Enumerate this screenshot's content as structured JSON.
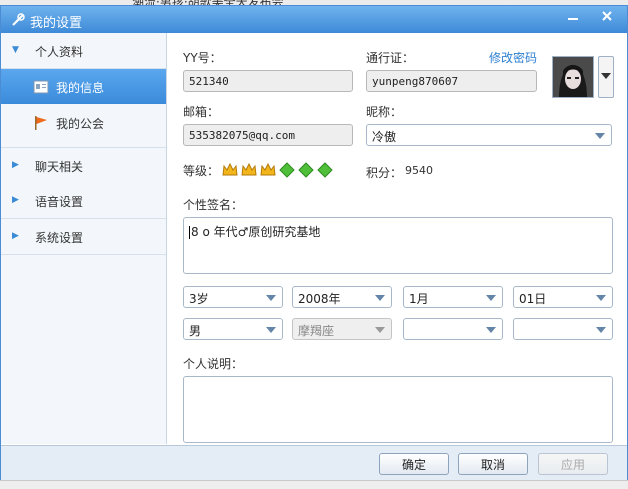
{
  "background": {
    "behind_text": "潮流·男孩·胡歌美全天发布会"
  },
  "window": {
    "title": "我的设置"
  },
  "sidebar": {
    "groups": [
      {
        "label": "个人资料",
        "expanded": true
      },
      {
        "label": "聊天相关",
        "expanded": false
      },
      {
        "label": "语音设置",
        "expanded": false
      },
      {
        "label": "系统设置",
        "expanded": false
      }
    ],
    "subitems": [
      {
        "label": "我的信息",
        "active": true
      },
      {
        "label": "我的公会",
        "active": false
      }
    ]
  },
  "profile": {
    "yy_label": "YY号：",
    "yy_value": "521340",
    "passport_label": "通行证：",
    "passport_value": "yunpeng870607",
    "change_password": "修改密码",
    "email_label": "邮箱：",
    "email_value": "535382075@qq.com",
    "nickname_label": "昵称：",
    "nickname_value": "冷傲",
    "level_label": "等级：",
    "level_badges": [
      "crown",
      "crown",
      "crown",
      "diamond",
      "diamond",
      "diamond"
    ],
    "points_label": "积分：",
    "points_value": "9540",
    "signature_label": "个性签名：",
    "signature_value": "8 o 年代♂原创研究基地",
    "age": "3岁",
    "year": "2008年",
    "month": "1月",
    "day": "01日",
    "gender": "男",
    "zodiac": "摩羯座",
    "province": "",
    "city": "",
    "about_label": "个人说明：",
    "about_value": ""
  },
  "buttons": {
    "ok": "确定",
    "cancel": "取消",
    "apply": "应用"
  },
  "colors": {
    "accent": "#3e8ad8",
    "titlebar": "#5aa2e6",
    "link": "#2c7fd0"
  }
}
